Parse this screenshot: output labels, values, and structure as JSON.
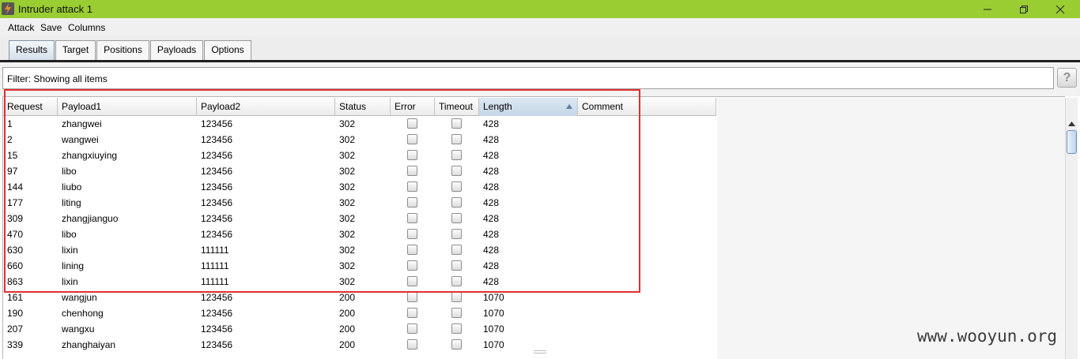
{
  "window": {
    "title": "Intruder attack 1",
    "controls": {
      "minimize_icon": "minimize-icon",
      "maximize_icon": "restore-icon",
      "close_icon": "close-icon"
    }
  },
  "menu": [
    "Attack",
    "Save",
    "Columns"
  ],
  "tabs": [
    {
      "label": "Results",
      "active": true
    },
    {
      "label": "Target",
      "active": false
    },
    {
      "label": "Positions",
      "active": false
    },
    {
      "label": "Payloads",
      "active": false
    },
    {
      "label": "Options",
      "active": false
    }
  ],
  "filter": {
    "text": "Filter:  Showing all items",
    "help_label": "?"
  },
  "table": {
    "columns": [
      "Request",
      "Payload1",
      "Payload2",
      "Status",
      "Error",
      "Timeout",
      "Length",
      "Comment"
    ],
    "sorted_column": "Length",
    "sort_direction": "ascending",
    "rows": [
      {
        "request": "1",
        "payload1": "zhangwei",
        "payload2": "123456",
        "status": "302",
        "error": false,
        "timeout": false,
        "length": "428",
        "comment": ""
      },
      {
        "request": "2",
        "payload1": "wangwei",
        "payload2": "123456",
        "status": "302",
        "error": false,
        "timeout": false,
        "length": "428",
        "comment": ""
      },
      {
        "request": "15",
        "payload1": "zhangxiuying",
        "payload2": "123456",
        "status": "302",
        "error": false,
        "timeout": false,
        "length": "428",
        "comment": ""
      },
      {
        "request": "97",
        "payload1": "libo",
        "payload2": "123456",
        "status": "302",
        "error": false,
        "timeout": false,
        "length": "428",
        "comment": ""
      },
      {
        "request": "144",
        "payload1": "liubo",
        "payload2": "123456",
        "status": "302",
        "error": false,
        "timeout": false,
        "length": "428",
        "comment": ""
      },
      {
        "request": "177",
        "payload1": "liting",
        "payload2": "123456",
        "status": "302",
        "error": false,
        "timeout": false,
        "length": "428",
        "comment": ""
      },
      {
        "request": "309",
        "payload1": "zhangjianguo",
        "payload2": "123456",
        "status": "302",
        "error": false,
        "timeout": false,
        "length": "428",
        "comment": ""
      },
      {
        "request": "470",
        "payload1": "libo",
        "payload2": "123456",
        "status": "302",
        "error": false,
        "timeout": false,
        "length": "428",
        "comment": ""
      },
      {
        "request": "630",
        "payload1": "lixin",
        "payload2": "111111",
        "status": "302",
        "error": false,
        "timeout": false,
        "length": "428",
        "comment": ""
      },
      {
        "request": "660",
        "payload1": "lining",
        "payload2": "111111",
        "status": "302",
        "error": false,
        "timeout": false,
        "length": "428",
        "comment": ""
      },
      {
        "request": "863",
        "payload1": "lixin",
        "payload2": "111111",
        "status": "302",
        "error": false,
        "timeout": false,
        "length": "428",
        "comment": ""
      },
      {
        "request": "161",
        "payload1": "wangjun",
        "payload2": "123456",
        "status": "200",
        "error": false,
        "timeout": false,
        "length": "1070",
        "comment": ""
      },
      {
        "request": "190",
        "payload1": "chenhong",
        "payload2": "123456",
        "status": "200",
        "error": false,
        "timeout": false,
        "length": "1070",
        "comment": ""
      },
      {
        "request": "207",
        "payload1": "wangxu",
        "payload2": "123456",
        "status": "200",
        "error": false,
        "timeout": false,
        "length": "1070",
        "comment": ""
      },
      {
        "request": "339",
        "payload1": "zhanghaiyan",
        "payload2": "123456",
        "status": "200",
        "error": false,
        "timeout": false,
        "length": "1070",
        "comment": ""
      }
    ]
  },
  "annotation": {
    "highlight_color": "#e03030"
  },
  "watermark": "www.wooyun.org",
  "colors": {
    "titlebar": "#9acd32",
    "active_tab": "#d5e0ea",
    "sort_arrow": "#5b7fa8"
  }
}
